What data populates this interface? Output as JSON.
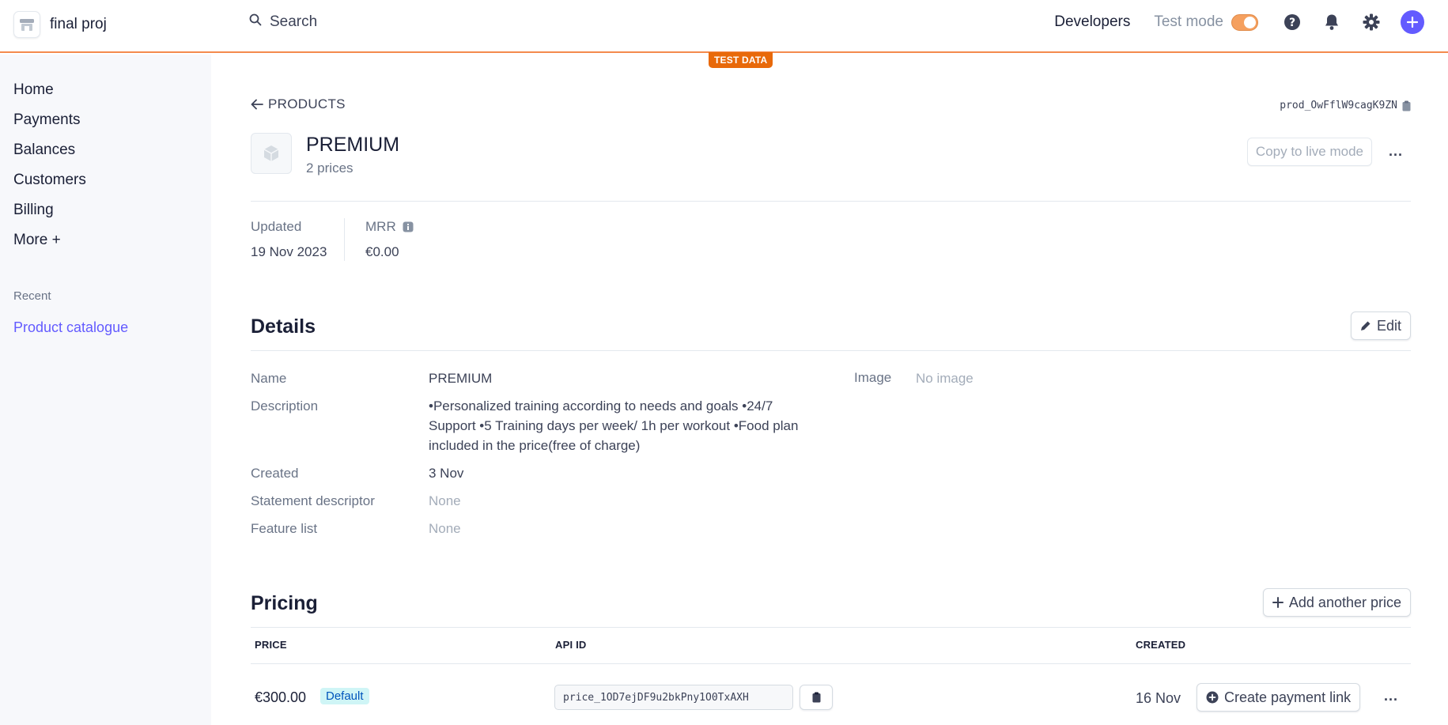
{
  "topbar": {
    "account_name": "final proj",
    "search_placeholder": "Search",
    "developers_label": "Developers",
    "test_mode_label": "Test mode",
    "test_mode_enabled": true,
    "accent_color": "#635bff",
    "test_color": "#e8690a",
    "icons": [
      "search-icon",
      "help-icon",
      "bell-icon",
      "gear-icon",
      "plus-icon"
    ]
  },
  "test_data_badge": "TEST DATA",
  "sidebar": {
    "items": [
      {
        "label": "Home"
      },
      {
        "label": "Payments"
      },
      {
        "label": "Balances"
      },
      {
        "label": "Customers"
      },
      {
        "label": "Billing"
      },
      {
        "label": "More +"
      }
    ],
    "recent_label": "Recent",
    "recent_items": [
      {
        "label": "Product catalogue"
      }
    ]
  },
  "product": {
    "back_label": "PRODUCTS",
    "id": "prod_OwFflW9cagK9ZN",
    "title": "PREMIUM",
    "subtitle": "2 prices",
    "copy_live_label": "Copy to live mode",
    "more_label": "...",
    "stats": {
      "updated_label": "Updated",
      "updated_value": "19 Nov 2023",
      "mrr_label": "MRR",
      "mrr_value": "€0.00"
    }
  },
  "details": {
    "title": "Details",
    "edit_label": "Edit",
    "name_label": "Name",
    "name_value": "PREMIUM",
    "description_label": "Description",
    "description_value": "•Personalized training according to needs and goals •24/7 Support •5 Training days per week/ 1h per workout •Food plan included in the price(free of charge)",
    "created_label": "Created",
    "created_value": "3 Nov",
    "statement_label": "Statement descriptor",
    "statement_value": "None",
    "feature_label": "Feature list",
    "feature_value": "None",
    "image_label": "Image",
    "image_value": "No image"
  },
  "pricing": {
    "title": "Pricing",
    "add_label": "Add another price",
    "columns": {
      "price": "PRICE",
      "api_id": "API ID",
      "created": "CREATED"
    },
    "rows": [
      {
        "price": "€300.00",
        "badge": "Default",
        "api_id": "price_1OD7ejDF9u2bkPny1O0TxAXH",
        "created": "16 Nov",
        "action_label": "Create payment link",
        "more_label": "..."
      }
    ]
  }
}
